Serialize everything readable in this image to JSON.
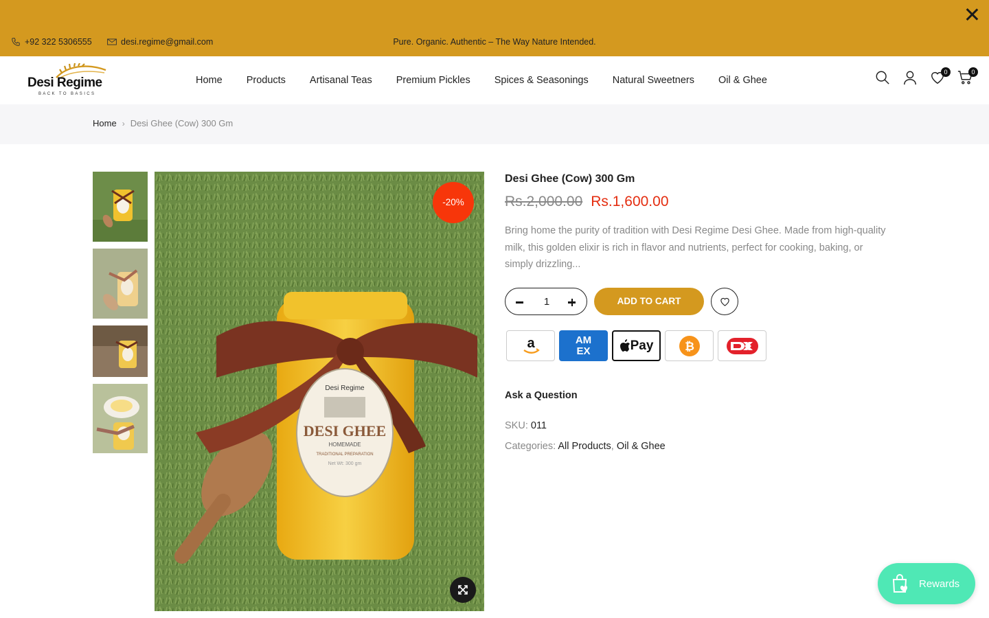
{
  "topbar": {
    "phone": "+92 322 5306555",
    "email": "desi.regime@gmail.com",
    "tagline": "Pure. Organic. Authentic – The Way Nature Intended.",
    "background": "#d4991f"
  },
  "header": {
    "logo_name": "Desi Regime",
    "logo_tagline": "BACK TO BASICS",
    "nav": [
      "Home",
      "Products",
      "Artisanal Teas",
      "Premium Pickles",
      "Spices & Seasonings",
      "Natural Sweetners",
      "Oil & Ghee"
    ],
    "wishlist_count": "0",
    "cart_count": "0"
  },
  "breadcrumb": {
    "home": "Home",
    "separator": "›",
    "current": "Desi Ghee (Cow) 300 Gm"
  },
  "gallery": {
    "sale_badge": "-20%",
    "label_brand": "Desi Regime",
    "label_title": "DESI GHEE",
    "label_subtitle": "HOMEMADE",
    "label_note": "TRADITIONAL PREPARATION",
    "label_weight": "Net Wt: 300 gm"
  },
  "product": {
    "title": "Desi Ghee (Cow) 300 Gm",
    "old_price": "Rs.2,000.00",
    "price": "Rs.1,600.00",
    "description": "Bring home the purity of tradition with Desi Regime Desi Ghee. Made from high-quality milk, this golden elixir is rich in flavor and nutrients, perfect for cooking, baking, or simply drizzling...",
    "quantity": "1",
    "add_to_cart": "ADD TO CART",
    "ask_question": "Ask a Question",
    "sku_label": "SKU:",
    "sku": "011",
    "categories_label": "Categories:",
    "categories": [
      "All Products",
      "Oil & Ghee"
    ],
    "price_color": "#e42d10"
  },
  "payments": {
    "amex_line1": "AM",
    "amex_line2": "EX",
    "apple": "Pay"
  },
  "rewards": {
    "label": "Rewards",
    "color": "#4fe8b5"
  }
}
